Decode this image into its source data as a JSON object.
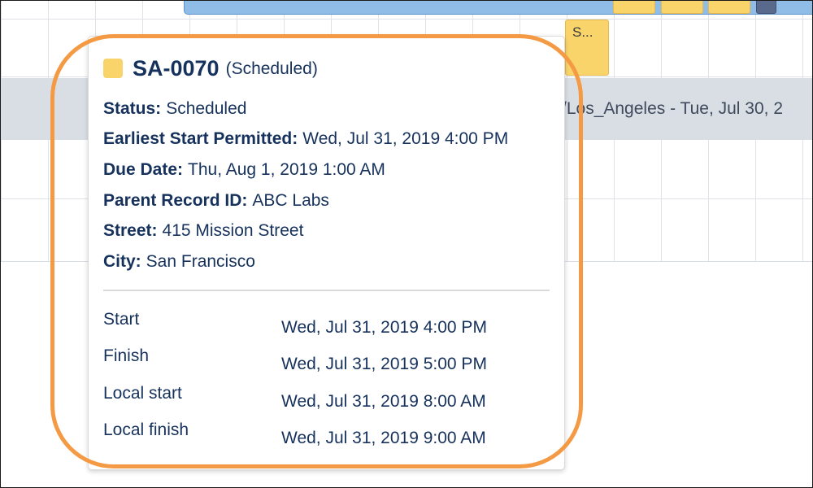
{
  "background": {
    "appointment_chip_label": "S...",
    "timezone_text": "/Los_Angeles - Tue, Jul 30, 2",
    "colors": {
      "top_bar": "#8fbde8",
      "chip_yellow": "#f9d46b",
      "chip_dark": "#5a6a8c"
    }
  },
  "popover": {
    "status_color": "#f9d46b",
    "highlight_color": "#f59a44",
    "title_id": "SA-0070",
    "title_status": "(Scheduled)",
    "fields": [
      {
        "label": "Status:",
        "value": "Scheduled"
      },
      {
        "label": "Earliest Start Permitted:",
        "value": "Wed, Jul 31, 2019 4:00 PM"
      },
      {
        "label": "Due Date:",
        "value": "Thu, Aug 1, 2019 1:00 AM"
      },
      {
        "label": "Parent Record ID:",
        "value": "ABC Labs"
      },
      {
        "label": "Street:",
        "value": "415 Mission Street"
      },
      {
        "label": "City:",
        "value": "San Francisco"
      }
    ],
    "times": [
      {
        "label": "Start",
        "value": "Wed, Jul 31, 2019 4:00 PM"
      },
      {
        "label": "Finish",
        "value": "Wed, Jul 31, 2019 5:00 PM"
      },
      {
        "label": "Local start",
        "value": "Wed, Jul 31, 2019 8:00 AM"
      },
      {
        "label": "Local finish",
        "value": "Wed, Jul 31, 2019 9:00 AM"
      }
    ]
  }
}
